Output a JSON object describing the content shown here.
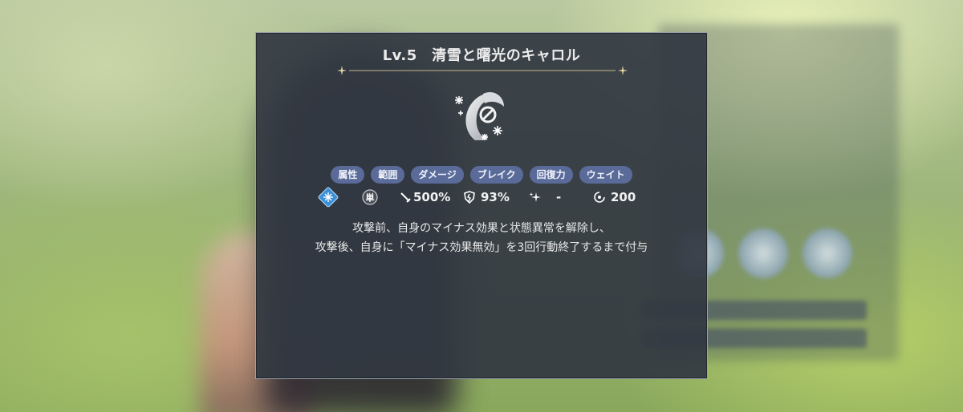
{
  "dialog": {
    "title": "Lv.5　清雪と曙光のキャロル",
    "skill_icon": "snowflake-staff-icon",
    "tags": [
      "属性",
      "範囲",
      "ダメージ",
      "ブレイク",
      "回復力",
      "ウェイト"
    ],
    "stats": {
      "attribute_icon": "ice-element-icon",
      "range_icon": "single-target-icon",
      "range_glyph": "単",
      "damage": "500%",
      "break": "93%",
      "recovery": "-",
      "wait": "200"
    },
    "description": [
      "攻撃前、自身のマイナス効果と状態異常を解除し、",
      "攻撃後、自身に「マイナス効果無効」を3回行動終了するまで付与"
    ]
  },
  "colors": {
    "panel_bg": "#32384299",
    "tag_bg": "#5a6b9a",
    "ice_blue": "#3a8fd9",
    "gold_line": "#c8b68a"
  }
}
